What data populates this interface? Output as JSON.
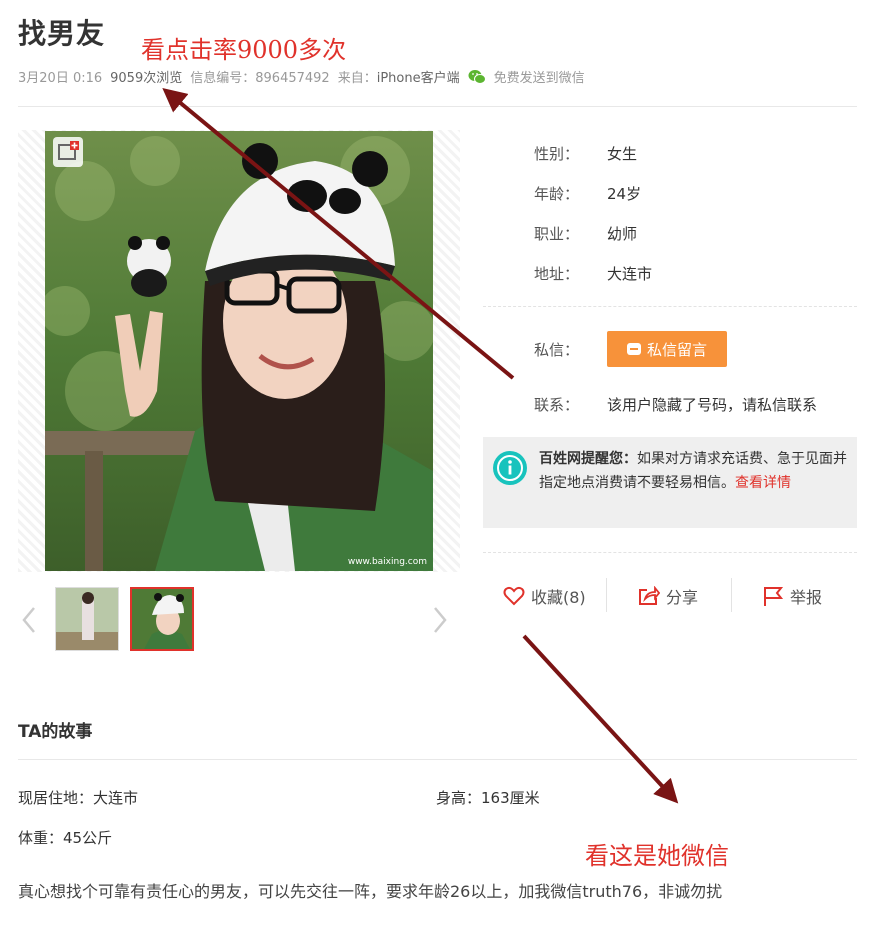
{
  "post": {
    "title": "找男友",
    "date": "3月20日 0:16",
    "views": "9059次浏览",
    "id_label": "信息编号：",
    "id_value": "896457492",
    "source_label": "来自：",
    "source_value": "iPhone客户端",
    "share_wechat": "免费发送到微信"
  },
  "annotations": {
    "clicks": "看点击率9000多次",
    "wechat": "看这是她微信"
  },
  "photo": {
    "watermark": "www.baixing.com",
    "thumbs": [
      "thumb-1",
      "thumb-2"
    ],
    "active_thumb": 2
  },
  "profile": {
    "fields": [
      {
        "label": "性别：",
        "value": "女生"
      },
      {
        "label": "年龄：",
        "value": "24岁"
      },
      {
        "label": "职业：",
        "value": "幼师"
      },
      {
        "label": "地址：",
        "value": "大连市"
      }
    ],
    "message_label": "私信：",
    "message_button": "私信留言",
    "contact_label": "联系：",
    "contact_value": "该用户隐藏了号码，请私信联系"
  },
  "warning": {
    "title": "百姓网提醒您：",
    "text": "如果对方请求充话费、急于见面并指定地点消费请不要轻易相信。",
    "link": "查看详情"
  },
  "actions": {
    "favorite": "收藏(8)",
    "share": "分享",
    "report": "举报"
  },
  "story": {
    "title": "TA的故事",
    "residence": "现居住地：大连市",
    "height": "身高：163厘米",
    "weight": "体重：45公斤",
    "description": "真心想找个可靠有责任心的男友，可以先交往一阵，要求年龄26以上，加我微信truth76，非诚勿扰"
  },
  "colors": {
    "accent_orange": "#f7923a",
    "annotation_red": "#e0322b",
    "arrow_darkred": "#7a1414",
    "warn_teal": "#18c3bd",
    "action_red": "#e0322b"
  }
}
